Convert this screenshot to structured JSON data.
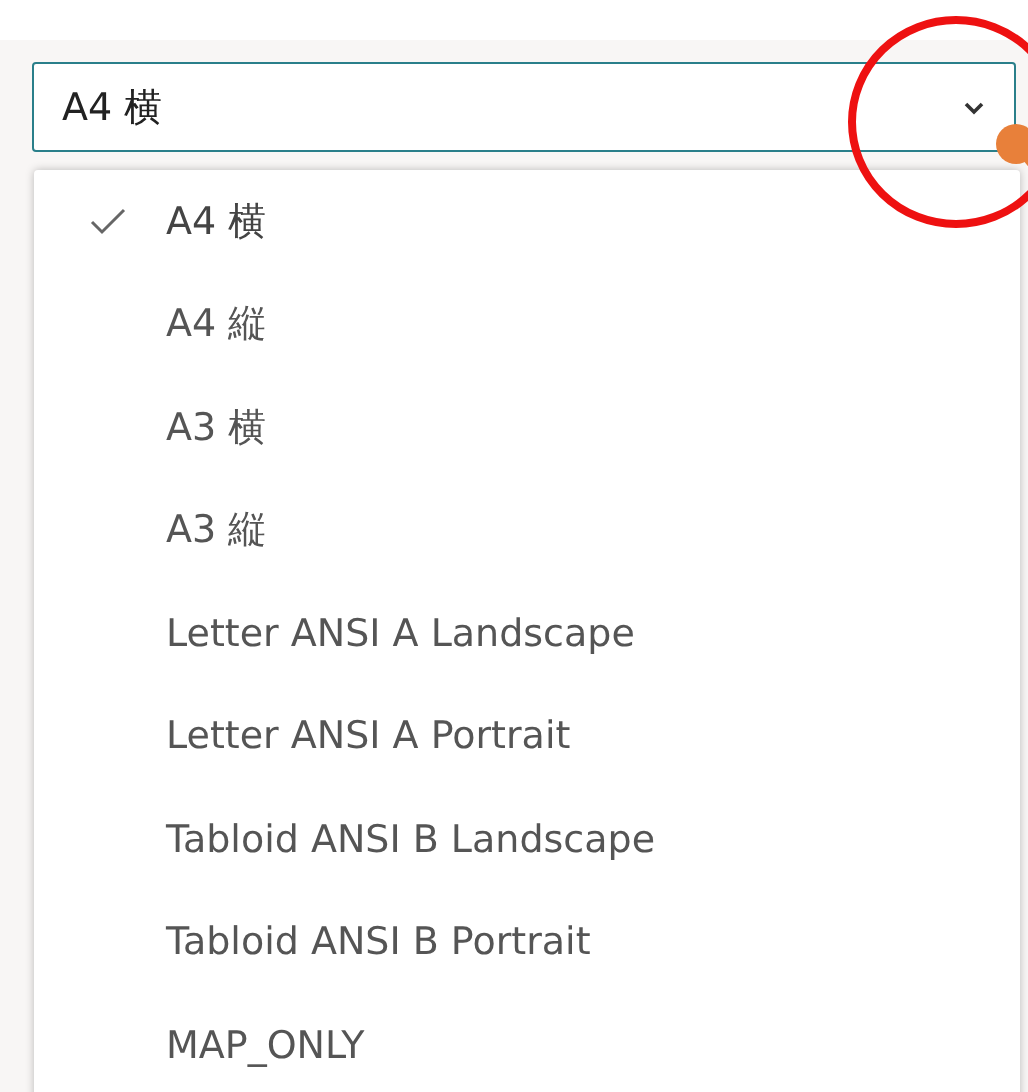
{
  "select": {
    "value": "A4 横",
    "expanded": true
  },
  "options": [
    {
      "label": "A4 横",
      "selected": true
    },
    {
      "label": "A4 縦",
      "selected": false
    },
    {
      "label": "A3 横",
      "selected": false
    },
    {
      "label": "A3 縦",
      "selected": false
    },
    {
      "label": "Letter ANSI A Landscape",
      "selected": false
    },
    {
      "label": "Letter ANSI A Portrait",
      "selected": false
    },
    {
      "label": "Tabloid ANSI B Landscape",
      "selected": false
    },
    {
      "label": "Tabloid ANSI B Portrait",
      "selected": false
    },
    {
      "label": "MAP_ONLY",
      "selected": false
    }
  ]
}
